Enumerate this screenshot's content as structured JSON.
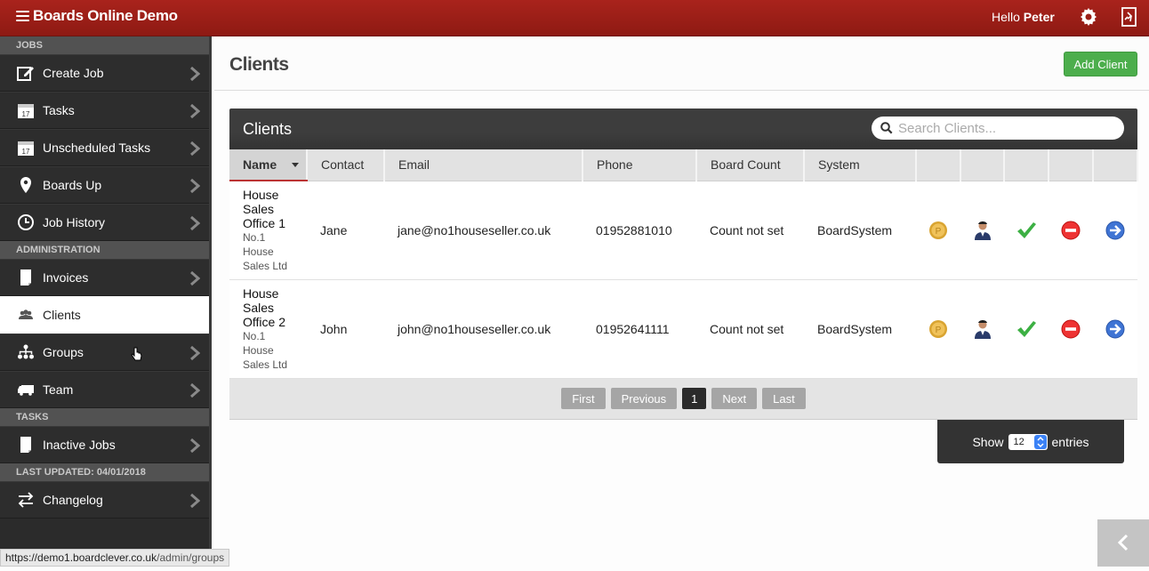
{
  "app": {
    "title": "Boards Online Demo",
    "greeting_prefix": "Hello",
    "user": "Peter"
  },
  "sidebar": {
    "sections": [
      {
        "label": "JOBS",
        "items": [
          {
            "label": "Create Job",
            "icon": "edit-icon"
          },
          {
            "label": "Tasks",
            "icon": "calendar-icon"
          },
          {
            "label": "Unscheduled Tasks",
            "icon": "calendar-icon"
          },
          {
            "label": "Boards Up",
            "icon": "map-pin-icon"
          },
          {
            "label": "Job History",
            "icon": "clock-icon"
          }
        ]
      },
      {
        "label": "ADMINISTRATION",
        "items": [
          {
            "label": "Invoices",
            "icon": "document-icon"
          },
          {
            "label": "Clients",
            "icon": "users-icon",
            "active": true
          },
          {
            "label": "Groups",
            "icon": "hierarchy-icon"
          },
          {
            "label": "Team",
            "icon": "truck-icon"
          }
        ]
      },
      {
        "label": "TASKS",
        "items": [
          {
            "label": "Inactive Jobs",
            "icon": "document-icon"
          }
        ]
      },
      {
        "label": "LAST UPDATED: 04/01/2018",
        "items": [
          {
            "label": "Changelog",
            "icon": "swap-icon"
          }
        ]
      }
    ]
  },
  "page": {
    "title": "Clients",
    "add_button": "Add Client"
  },
  "panel": {
    "title": "Clients",
    "search_placeholder": "Search Clients...",
    "columns": [
      "Name",
      "Contact",
      "Email",
      "Phone",
      "Board Count",
      "System"
    ],
    "rows": [
      {
        "name": "House Sales Office 1",
        "company": "No.1 House Sales Ltd",
        "contact": "Jane",
        "email": "jane@no1houseseller.co.uk",
        "phone": "01952881010",
        "board_count": "Count not set",
        "system": "BoardSystem"
      },
      {
        "name": "House Sales Office 2",
        "company": "No.1 House Sales Ltd",
        "contact": "John",
        "email": "john@no1houseseller.co.uk",
        "phone": "01952641111",
        "board_count": "Count not set",
        "system": "BoardSystem"
      }
    ],
    "pager": {
      "first": "First",
      "previous": "Previous",
      "current": "1",
      "next": "Next",
      "last": "Last"
    },
    "show": {
      "prefix": "Show",
      "value": "12",
      "suffix": "entries"
    }
  },
  "status_url": {
    "host": "https://demo1.boardclever.co.uk",
    "path": "/admin/groups"
  },
  "colors": {
    "topbar": "#9b1f17",
    "sidebar": "#2b2b2b",
    "accent_green": "#4cae4c"
  }
}
